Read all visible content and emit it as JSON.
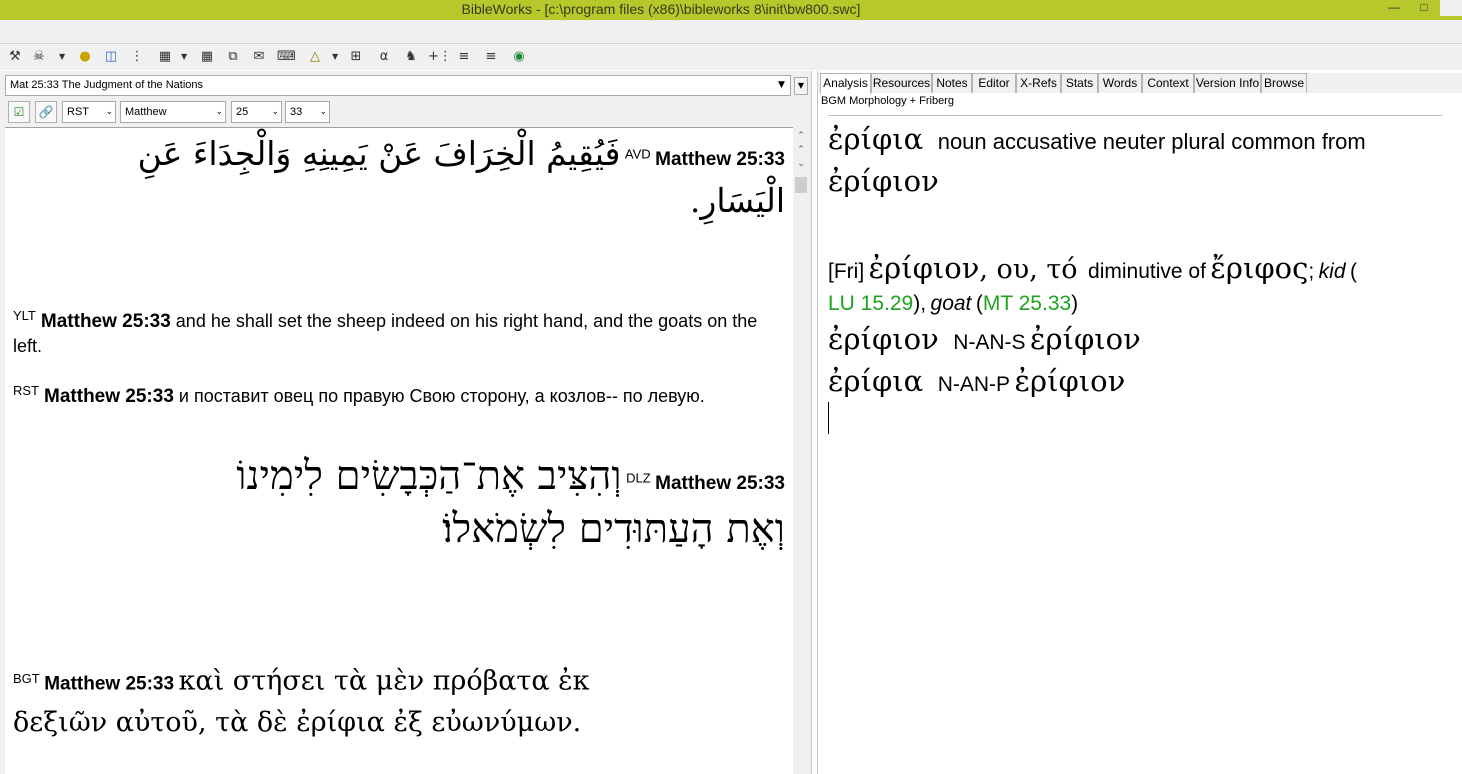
{
  "window": {
    "title": "BibleWorks - [c:\\program files (x86)\\bibleworks 8\\init\\bw800.swc]"
  },
  "toolbar": {
    "icons": [
      "tool-1-icon",
      "tool-2-icon",
      "tool-3-icon",
      "tool-4-icon",
      "tool-5-icon",
      "tool-6-icon",
      "tool-7-icon",
      "tool-8-icon",
      "tool-9-icon",
      "tool-10-icon",
      "tool-11-icon",
      "tool-12-icon",
      "tool-13-icon",
      "tool-14-icon",
      "tool-15-icon",
      "tool-16-icon",
      "tool-17-icon",
      "tool-18-icon",
      "globe-icon"
    ]
  },
  "left": {
    "ref_combo": "Mat 25:33 The Judgment of the Nations",
    "version_select": "RST",
    "book_select": "Matthew",
    "chapter_select": "25",
    "verse_select": "33",
    "verses": {
      "avd": {
        "version": "AVD",
        "ref": "Matthew 25:33",
        "text_line1": "فَيُقِيمُ الْخِرَافَ عَنْ يَمِينِهِ وَالْجِدَاءَ عَنِ",
        "text_line2": "الْيَسَارِ."
      },
      "ylt": {
        "version": "YLT",
        "ref": "Matthew 25:33",
        "text": "and he shall set the sheep indeed on his right hand, and the goats on the left."
      },
      "rst": {
        "version": "RST",
        "ref": "Matthew 25:33",
        "text": "и поставит овец по правую Свою сторону, а козлов-- по левую."
      },
      "dlz": {
        "version": "DLZ",
        "ref": "Matthew 25:33",
        "text_line1": "וְהִצִּיב אֶת־הַכְּבָשִׂים לִימִינוֹ",
        "text_line2": "וְאֶת הָעַתּוּדִים לִשְׂמֹאלוֹ׃"
      },
      "bgt": {
        "version": "BGT",
        "ref": "Matthew 25:33",
        "text_line1": "καὶ στήσει τὰ μὲν πρόβατα ἐκ",
        "text_line2": "δεξιῶν αὐτοῦ, τὰ δὲ ἐρίφια ἐξ εὐωνύμων."
      }
    }
  },
  "right": {
    "tabs": [
      "Analysis",
      "Resources",
      "Notes",
      "Editor",
      "X-Refs",
      "Stats",
      "Words",
      "Context",
      "Version Info",
      "Browse"
    ],
    "subtitle": "BGM Morphology + Friberg",
    "analysis": {
      "word": "ἐρίφια",
      "desc": "noun accusative neuter plural common from",
      "lemma": "ἐρίφιον",
      "fri_tag": "[Fri]",
      "fri_lemma": "ἐρίφιον",
      "fri_forms": ", ου, τό",
      "fri_diminutive": "diminutive of",
      "fri_root": "ἔριφος",
      "fri_semi": ";",
      "fri_kid": "kid",
      "fri_paren_open": "(",
      "fri_ref1": "LU 15.29",
      "fri_paren_close": "),",
      "fri_goat": "goat",
      "fri_paren_open2": "(",
      "fri_ref2": "MT 25.33",
      "fri_paren_close2": ")",
      "row1_word": "ἐρίφιον",
      "row1_code": "N-AN-S",
      "row1_lemma": "ἐρίφιον",
      "row2_word": "ἐρίφια",
      "row2_code": "N-AN-P",
      "row2_lemma": "ἐρίφιον"
    }
  },
  "colors": {
    "titlebar": "#b7c82b",
    "link_green": "#1fa31f"
  }
}
